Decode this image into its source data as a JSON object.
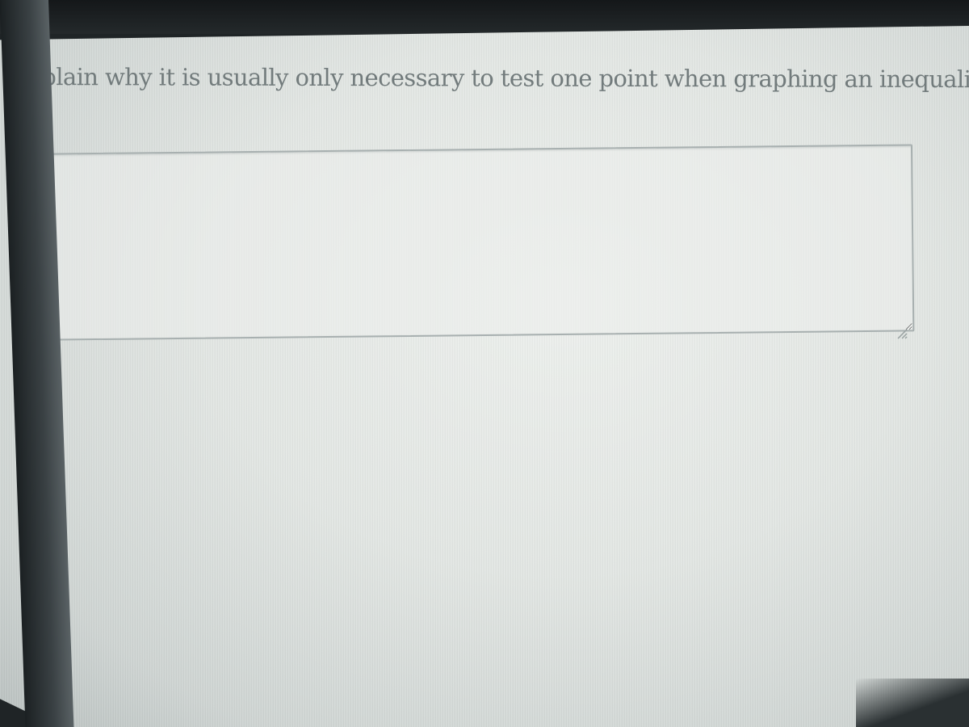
{
  "question": {
    "prompt": "Explain why it is usually only necessary to test one point when graphing an inequality."
  },
  "answer": {
    "value": "",
    "placeholder": ""
  },
  "icons": {
    "resize_grip": "resize-grip-icon"
  },
  "colors": {
    "prompt_text": "#727b7c",
    "screen_background": "#e3e7e4",
    "box_border": "#a8b0b0"
  }
}
